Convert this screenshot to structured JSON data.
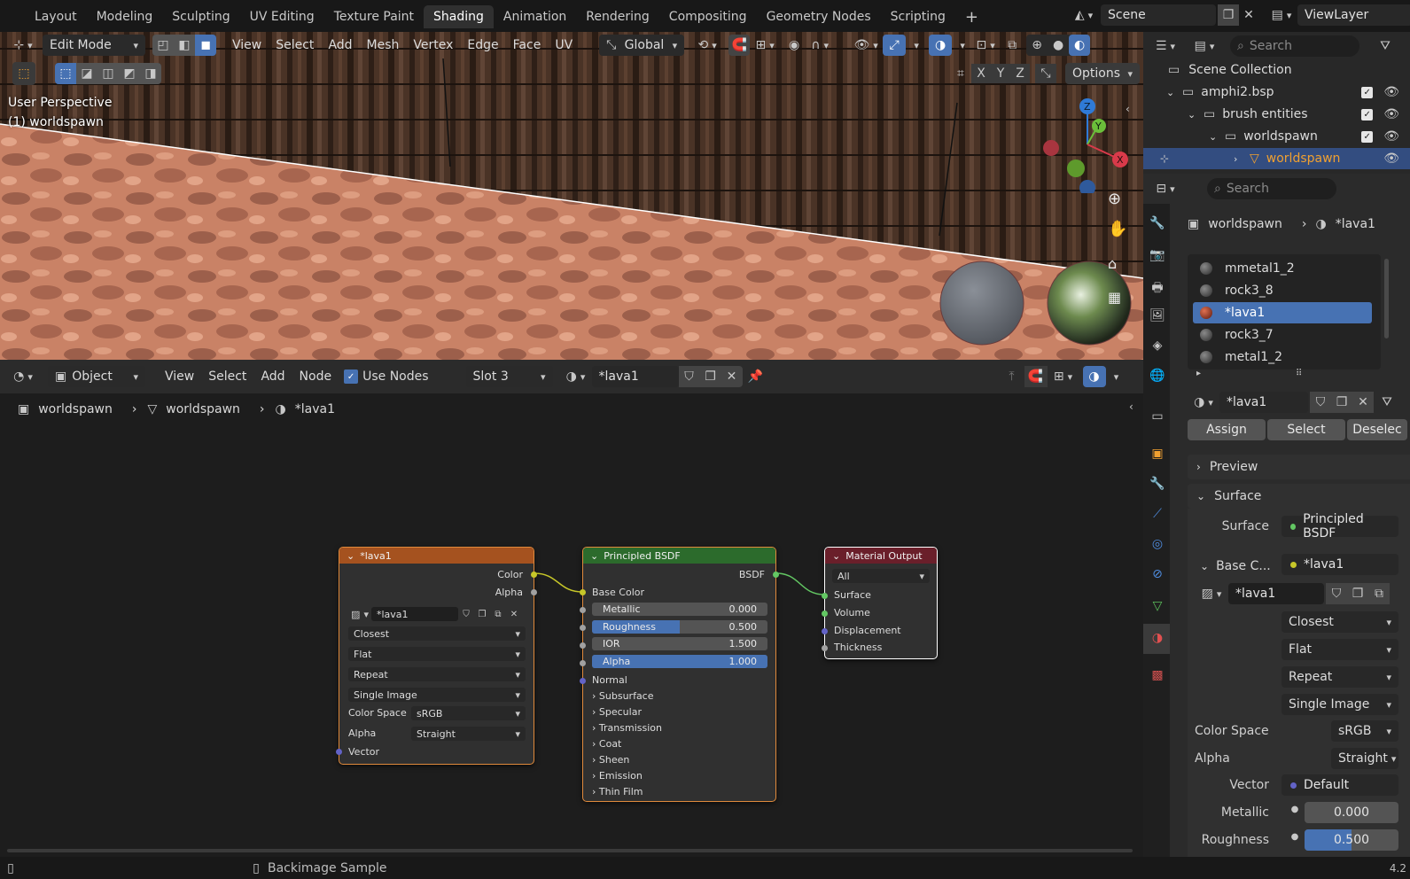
{
  "workspaces": {
    "tabs": [
      "Layout",
      "Modeling",
      "Sculpting",
      "UV Editing",
      "Texture Paint",
      "Shading",
      "Animation",
      "Rendering",
      "Compositing",
      "Geometry Nodes",
      "Scripting"
    ],
    "active": "Shading",
    "add_symbol": "+",
    "scene": "Scene",
    "view_layer": "ViewLayer"
  },
  "viewport": {
    "mode": "Edit Mode",
    "menus": [
      "View",
      "Select",
      "Add",
      "Mesh",
      "Vertex",
      "Edge",
      "Face",
      "UV"
    ],
    "transform_orientation": "Global",
    "axes": [
      "X",
      "Y",
      "Z"
    ],
    "options": "Options",
    "perspective": "User Perspective",
    "object_label": "(1) worldspawn",
    "gizmo": {
      "z": "Z",
      "y": "Y",
      "x": "X"
    }
  },
  "node_editor": {
    "object_type": "Object",
    "menus": [
      "View",
      "Select",
      "Add",
      "Node"
    ],
    "use_nodes_label": "Use Nodes",
    "use_nodes": true,
    "slot": "Slot 3",
    "material": "*lava1",
    "breadcrumb": [
      "worldspawn",
      "worldspawn",
      "*lava1"
    ],
    "image_node": {
      "title": "*lava1",
      "out_color": "Color",
      "out_alpha": "Alpha",
      "image": "*lava1",
      "interpolation": "Closest",
      "projection": "Flat",
      "extension": "Repeat",
      "source": "Single Image",
      "color_space_label": "Color Space",
      "color_space": "sRGB",
      "alpha_label": "Alpha",
      "alpha": "Straight",
      "vector": "Vector"
    },
    "bsdf_node": {
      "title": "Principled BSDF",
      "out": "BSDF",
      "base_color": "Base Color",
      "metallic_label": "Metallic",
      "metallic": "0.000",
      "roughness_label": "Roughness",
      "roughness": "0.500",
      "roughness_fill": 0.5,
      "ior_label": "IOR",
      "ior": "1.500",
      "alpha_label": "Alpha",
      "alpha": "1.000",
      "alpha_fill": 1.0,
      "normal": "Normal",
      "panels": [
        "Subsurface",
        "Specular",
        "Transmission",
        "Coat",
        "Sheen",
        "Emission",
        "Thin Film"
      ]
    },
    "output_node": {
      "title": "Material Output",
      "target": "All",
      "inputs": [
        "Surface",
        "Volume",
        "Displacement",
        "Thickness"
      ]
    }
  },
  "outliner": {
    "search_placeholder": "Search",
    "rows": [
      {
        "label": "Scene Collection",
        "depth": 0
      },
      {
        "label": "amphi2.bsp",
        "depth": 1
      },
      {
        "label": "brush entities",
        "depth": 2
      },
      {
        "label": "worldspawn",
        "depth": 3
      },
      {
        "label": "worldspawn",
        "depth": 4
      }
    ]
  },
  "properties": {
    "search_placeholder": "Search",
    "breadcrumb_object": "worldspawn",
    "breadcrumb_material": "*lava1",
    "materials": [
      "mmetal1_2",
      "rock3_8",
      "*lava1",
      "rock3_7",
      "metal1_2"
    ],
    "active_material": "*lava1",
    "material_name": "*lava1",
    "assign": "Assign",
    "select": "Select",
    "deselect": "Deselec",
    "preview": "Preview",
    "surface_panel": "Surface",
    "surface_label": "Surface",
    "surface_value": "Principled BSDF",
    "base_color_label": "Base C...",
    "base_color_value": "*lava1",
    "image_name": "*lava1",
    "interpolation": "Closest",
    "projection": "Flat",
    "extension": "Repeat",
    "source": "Single Image",
    "color_space_label": "Color Space",
    "color_space": "sRGB",
    "alpha_label": "Alpha",
    "alpha": "Straight",
    "vector_label": "Vector",
    "vector": "Default",
    "metallic_label": "Metallic",
    "metallic": "0.000",
    "roughness_label": "Roughness",
    "roughness": "0.500"
  },
  "status": {
    "hint": "Backimage Sample",
    "version": "4.2"
  },
  "colors": {
    "accent": "#4772b3",
    "image_node_header": "#a5521f",
    "bsdf_header": "#2c6b2c",
    "output_header": "#6a1f2a",
    "socket_yellow": "#c7c729",
    "socket_green": "#63c763",
    "socket_grey": "#a1a1a1",
    "socket_purple": "#6363c7"
  }
}
